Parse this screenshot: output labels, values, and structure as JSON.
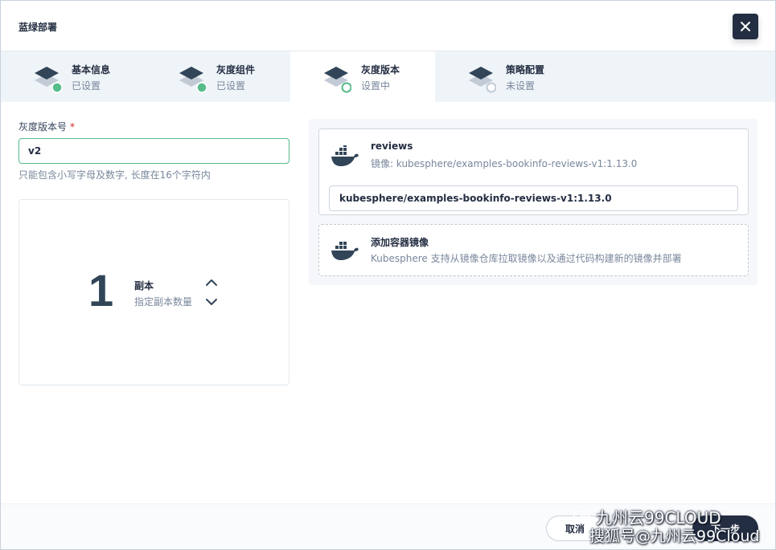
{
  "modal": {
    "title": "蓝绿部署"
  },
  "steps": [
    {
      "title": "基本信息",
      "desc": "已设置",
      "state": "done"
    },
    {
      "title": "灰度组件",
      "desc": "已设置",
      "state": "done"
    },
    {
      "title": "灰度版本",
      "desc": "设置中",
      "state": "active"
    },
    {
      "title": "策略配置",
      "desc": "未设置",
      "state": "pending"
    }
  ],
  "form": {
    "version_label": "灰度版本号",
    "required_mark": "*",
    "version_value": "v2",
    "version_hint": "只能包含小写字母及数字, 长度在16个字符内",
    "replicas": {
      "value": "1",
      "title": "副本",
      "desc": "指定副本数量"
    }
  },
  "container": {
    "name": "reviews",
    "image_desc": "镜像: kubesphere/examples-bookinfo-reviews-v1:1.13.0",
    "image_value": "kubesphere/examples-bookinfo-reviews-v1:1.13.0"
  },
  "add_container": {
    "title": "添加容器镜像",
    "desc": "Kubesphere 支持从镜像仓库拉取镜像以及通过代码构建新的镜像并部署"
  },
  "footer": {
    "cancel_label": "取消",
    "next_label": "下一步"
  },
  "watermark": {
    "line1": "九州云99CLOUD",
    "line2": "搜狐号@九州云99Cloud"
  },
  "colors": {
    "success": "#55bc8a",
    "dark": "#242e42",
    "muted": "#79879c",
    "step_bg": "#eff4f9"
  }
}
